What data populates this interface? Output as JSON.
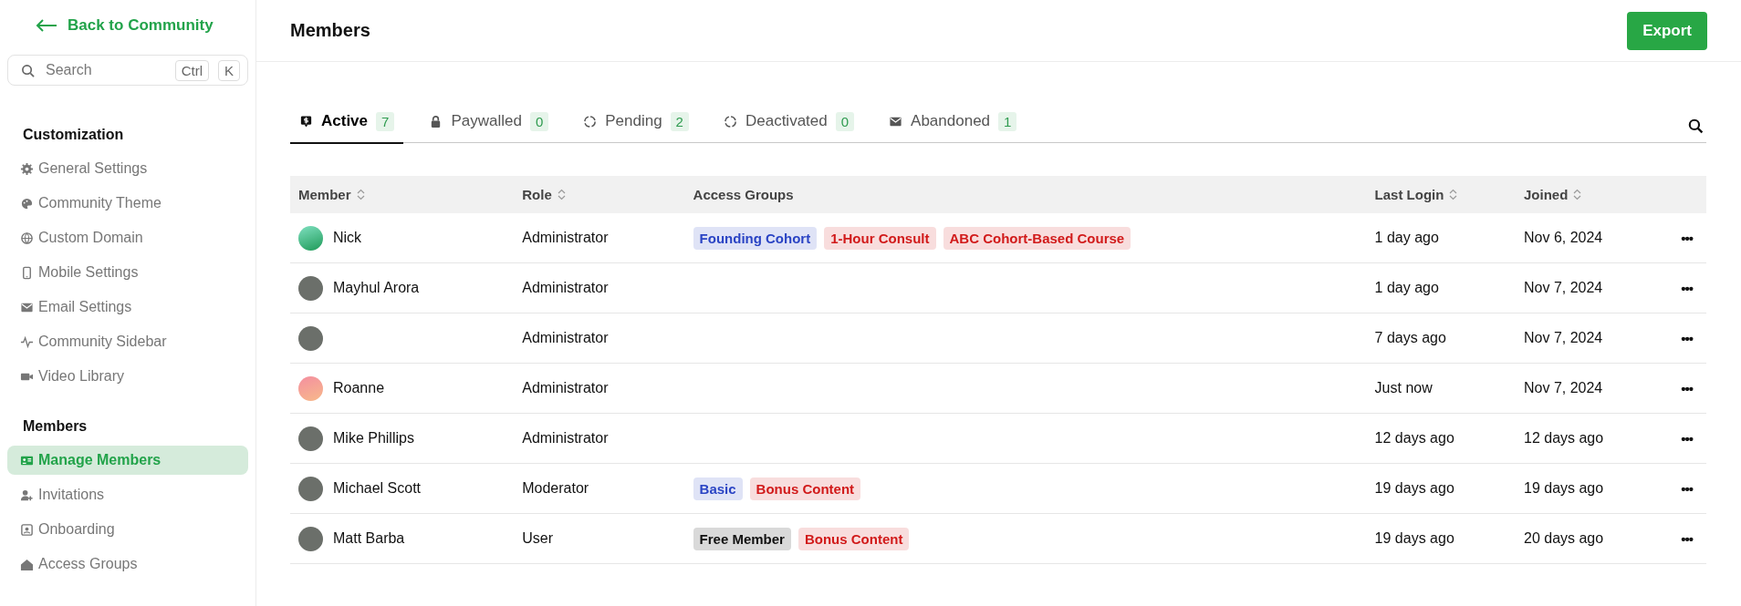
{
  "sidebar": {
    "back_link": "Back to Community",
    "search": {
      "placeholder": "Search",
      "shortcut": [
        "Ctrl",
        "K"
      ]
    },
    "sections": [
      {
        "title": "Customization",
        "items": [
          {
            "label": "General Settings",
            "selected": false
          },
          {
            "label": "Community Theme",
            "selected": false
          },
          {
            "label": "Custom Domain",
            "selected": false
          },
          {
            "label": "Mobile Settings",
            "selected": false
          },
          {
            "label": "Email Settings",
            "selected": false
          },
          {
            "label": "Community Sidebar",
            "selected": false
          },
          {
            "label": "Video Library",
            "selected": false
          }
        ]
      },
      {
        "title": "Members",
        "items": [
          {
            "label": "Manage Members",
            "selected": true
          },
          {
            "label": "Invitations",
            "selected": false
          },
          {
            "label": "Onboarding",
            "selected": false
          },
          {
            "label": "Access Groups",
            "selected": false
          }
        ]
      }
    ]
  },
  "header": {
    "title": "Members",
    "export_button": "Export"
  },
  "tabs": [
    {
      "label": "Active",
      "count": "7",
      "selected": true
    },
    {
      "label": "Paywalled",
      "count": "0",
      "selected": false
    },
    {
      "label": "Pending",
      "count": "2",
      "selected": false
    },
    {
      "label": "Deactivated",
      "count": "0",
      "selected": false
    },
    {
      "label": "Abandoned",
      "count": "1",
      "selected": false
    }
  ],
  "table": {
    "columns": [
      {
        "label": "Member",
        "sortable": true
      },
      {
        "label": "Role",
        "sortable": true
      },
      {
        "label": "Access Groups",
        "sortable": false
      },
      {
        "label": "Last Login",
        "sortable": true
      },
      {
        "label": "Joined",
        "sortable": true
      }
    ],
    "rows": [
      {
        "name": "Nick",
        "role": "Administrator",
        "groups": [
          {
            "label": "Founding Cohort",
            "color": "#2a44c4"
          },
          {
            "label": "1-Hour Consult",
            "color": "#d11a1a"
          },
          {
            "label": "ABC Cohort-Based Course",
            "color": "#d11a1a"
          }
        ],
        "last_login": "1 day ago",
        "joined": "Nov 6, 2024",
        "menu": "•••"
      },
      {
        "name": "Mayhul Arora",
        "role": "Administrator",
        "groups": [],
        "last_login": "1 day ago",
        "joined": "Nov 7, 2024",
        "menu": "•••"
      },
      {
        "role": "Administrator",
        "groups": [],
        "last_login": "7 days ago",
        "joined": "Nov 7, 2024",
        "menu": "•••"
      },
      {
        "name": "Roanne",
        "role": "Administrator",
        "groups": [],
        "last_login": "Just now",
        "joined": "Nov 7, 2024",
        "menu": "•••"
      },
      {
        "name": "Mike Phillips",
        "role": "Administrator",
        "groups": [],
        "last_login": "12 days ago",
        "joined": "12 days ago",
        "menu": "•••"
      },
      {
        "name": "Michael Scott",
        "role": "Moderator",
        "groups": [
          {
            "label": "Basic",
            "color": "#2a44c4"
          },
          {
            "label": "Bonus Content",
            "color": "#d11a1a"
          }
        ],
        "last_login": "19 days ago",
        "joined": "19 days ago",
        "menu": "•••"
      },
      {
        "name": "Matt Barba",
        "role": "User",
        "groups": [
          {
            "label": "Free Member",
            "color": "#111111"
          },
          {
            "label": "Bonus Content",
            "color": "#d11a1a"
          }
        ],
        "last_login": "19 days ago",
        "joined": "20 days ago",
        "menu": "•••"
      }
    ]
  }
}
